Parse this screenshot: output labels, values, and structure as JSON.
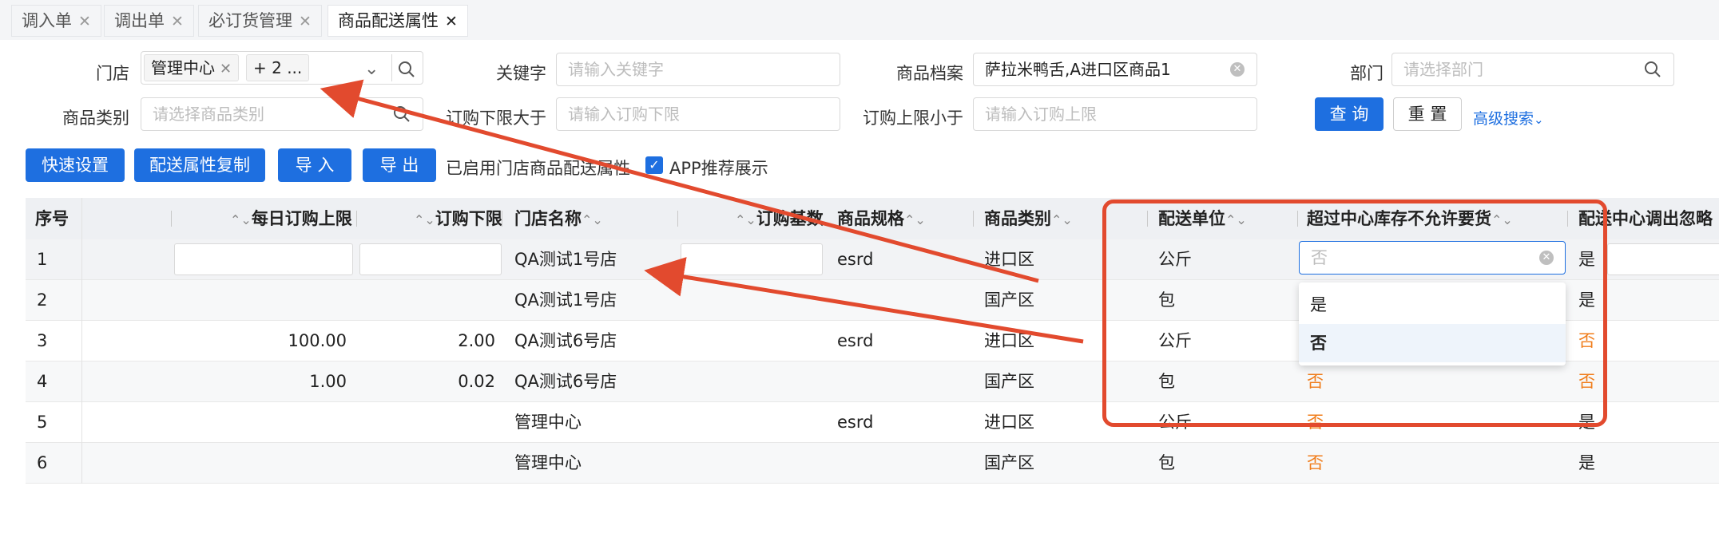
{
  "tabs": [
    {
      "label": "调入单",
      "active": false
    },
    {
      "label": "调出单",
      "active": false
    },
    {
      "label": "必订货管理",
      "active": false
    },
    {
      "label": "商品配送属性",
      "active": true
    }
  ],
  "filters": {
    "store": {
      "label": "门店",
      "tags": [
        "管理中心",
        "+ 2 ..."
      ]
    },
    "keyword": {
      "label": "关键字",
      "placeholder": "请输入关键字"
    },
    "product_file": {
      "label": "商品档案",
      "value": "萨拉米鸭舌,A进口区商品1"
    },
    "department": {
      "label": "部门",
      "placeholder": "请选择部门"
    },
    "category": {
      "label": "商品类别",
      "placeholder": "请选择商品类别"
    },
    "min_order_gt": {
      "label": "订购下限大于",
      "placeholder": "请输入订购下限"
    },
    "max_order_lt": {
      "label": "订购上限小于",
      "placeholder": "请输入订购上限"
    },
    "query_button": "查 询",
    "reset_button": "重 置",
    "advanced_search": "高级搜索"
  },
  "toolbar": {
    "quick_settings": "快速设置",
    "copy_attrs": "配送属性复制",
    "import": "导 入",
    "export": "导 出",
    "enabled_text": "已启用门店商品配送属性",
    "app_recommend": {
      "label": "APP推荐展示",
      "checked": true
    }
  },
  "table": {
    "headers": {
      "seq": "序号",
      "daily_max": "每日订购上限",
      "min_order": "订购下限",
      "store_name": "门店名称",
      "order_base": "订购基数",
      "spec": "商品规格",
      "category": "商品类别",
      "unit": "配送单位",
      "over_stock": "超过中心库存不允许要货",
      "ignore": "配送中心调出忽略"
    },
    "rows": [
      {
        "seq": "1",
        "daily_max": "",
        "min_order": "",
        "store": "QA测试1号店",
        "base": "",
        "spec": "esrd",
        "category": "进口区",
        "unit": "公斤",
        "over_stock": "否",
        "ignore": "是"
      },
      {
        "seq": "2",
        "daily_max": "",
        "min_order": "",
        "store": "QA测试1号店",
        "base": "",
        "spec": "",
        "category": "国产区",
        "unit": "包",
        "over_stock": "",
        "ignore": "是"
      },
      {
        "seq": "3",
        "daily_max": "100.00",
        "min_order": "2.00",
        "store": "QA测试6号店",
        "base": "",
        "spec": "esrd",
        "category": "进口区",
        "unit": "公斤",
        "over_stock": "",
        "ignore": "否"
      },
      {
        "seq": "4",
        "daily_max": "1.00",
        "min_order": "0.02",
        "store": "QA测试6号店",
        "base": "",
        "spec": "",
        "category": "国产区",
        "unit": "包",
        "over_stock": "否",
        "ignore": "否"
      },
      {
        "seq": "5",
        "daily_max": "",
        "min_order": "",
        "store": "管理中心",
        "base": "",
        "spec": "esrd",
        "category": "进口区",
        "unit": "公斤",
        "over_stock": "否",
        "ignore": "是"
      },
      {
        "seq": "6",
        "daily_max": "",
        "min_order": "",
        "store": "管理中心",
        "base": "",
        "spec": "",
        "category": "国产区",
        "unit": "包",
        "over_stock": "否",
        "ignore": "是"
      }
    ]
  },
  "dropdown": {
    "placeholder": "否",
    "options": [
      "是",
      "否"
    ],
    "highlighted": "否"
  },
  "colors": {
    "primary": "#1e6fe0",
    "annotation": "#e24a2e",
    "no_value": "#f07c1a"
  }
}
